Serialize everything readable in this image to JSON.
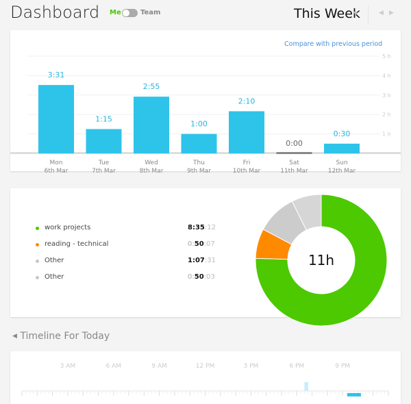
{
  "header": {
    "title": "Dashboard",
    "toggle_me": "Me",
    "toggle_team": "Team",
    "toggle_state": "Me",
    "period": "This Week",
    "prev_icon": "chevron-left",
    "next_icon": "chevron-right"
  },
  "compare_link": "Compare with previous period",
  "chart_data": [
    {
      "type": "bar",
      "categories": [
        "Mon 6th Mar",
        "Tue 7th Mar",
        "Wed 8th Mar",
        "Thu 9th Mar",
        "Fri 10th Mar",
        "Sat 11th Mar",
        "Sun 12th Mar"
      ],
      "day_labels": [
        "Mon",
        "Tue",
        "Wed",
        "Thu",
        "Fri",
        "Sat",
        "Sun"
      ],
      "date_labels": [
        "6th Mar",
        "7th Mar",
        "8th Mar",
        "9th Mar",
        "10th Mar",
        "11th Mar",
        "12th Mar"
      ],
      "values": [
        3.517,
        1.25,
        2.917,
        1.0,
        2.167,
        0,
        0.5
      ],
      "data_labels": [
        "3:31",
        "1:15",
        "2:55",
        "1:00",
        "2:10",
        "0:00",
        "0:30"
      ],
      "yticks": [
        "1 h",
        "2 h",
        "3 h",
        "4 h",
        "5 h"
      ],
      "ylim": [
        0,
        5
      ],
      "grid": true,
      "color": "#2ec4ea",
      "zero_color": "#888888"
    },
    {
      "type": "pie",
      "center_label": "11h",
      "slices": [
        {
          "name": "work projects",
          "value_seconds": 30912,
          "color": "#4cc900"
        },
        {
          "name": "reading - technical",
          "value_seconds": 3007,
          "color": "#ff8a00"
        },
        {
          "name": "Other",
          "value_seconds": 4051,
          "color": "#cccccc"
        },
        {
          "name": "Other",
          "value_seconds": 3003,
          "color": "#d6d6d6"
        }
      ]
    }
  ],
  "legend": [
    {
      "name": "work projects",
      "h": "",
      "hm": "8:35",
      "s": ":12",
      "color": "#4cc900"
    },
    {
      "name": "reading - technical",
      "h": "0:",
      "hm": "50",
      "s": ":07",
      "color": "#ff8a00"
    },
    {
      "name": "Other",
      "h": "",
      "hm": "1:07",
      "s": ":31",
      "color": "#c8c8c8"
    },
    {
      "name": "Other",
      "h": "0:",
      "hm": "50",
      "s": ":03",
      "color": "#c8c8c8"
    }
  ],
  "timeline": {
    "title": "Timeline For Today",
    "collapse_icon": "triangle-left",
    "hour_labels": [
      "3 AM",
      "6 AM",
      "9 AM",
      "12 PM",
      "3 PM",
      "6 PM",
      "9 PM"
    ],
    "entries": [
      {
        "start_hour": 18.5,
        "end_hour": 18.75,
        "color": "#c9eef8"
      },
      {
        "start_hour": 21.3,
        "end_hour": 22.2,
        "color": "#2ec4ea"
      }
    ]
  }
}
